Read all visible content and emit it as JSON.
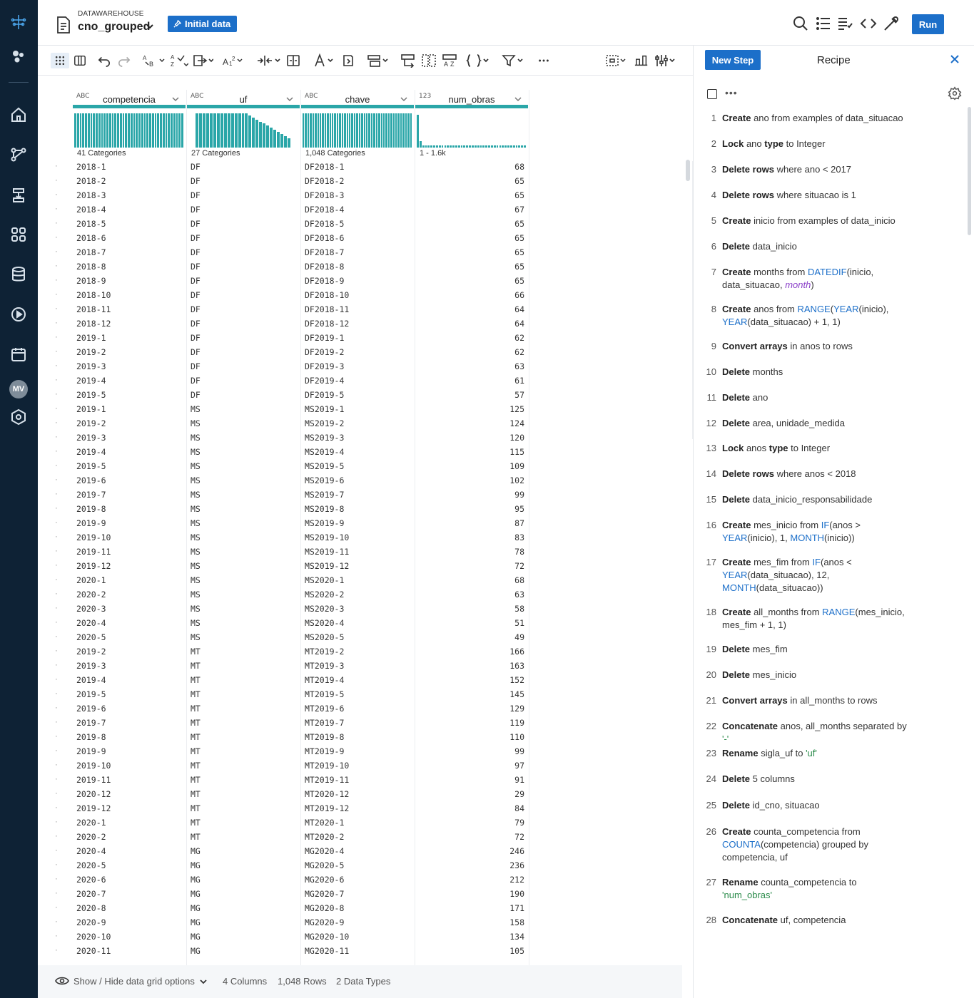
{
  "header": {
    "kicker": "DATAWAREHOUSE",
    "dataset_name": "cno_grouped",
    "initial_data_label": "Initial data",
    "run_label": "Run"
  },
  "grid": {
    "columns": [
      {
        "type_icon": "ABC",
        "name": "competencia",
        "summary": "41 Categories"
      },
      {
        "type_icon": "ABC",
        "name": "uf",
        "summary": "27 Categories"
      },
      {
        "type_icon": "ABC",
        "name": "chave",
        "summary": "1,048 Categories"
      },
      {
        "type_icon": "123",
        "name": "num_obras",
        "summary": "1 - 1.6k"
      }
    ],
    "rows": [
      [
        "2018-1",
        "DF",
        "DF2018-1",
        "68"
      ],
      [
        "2018-2",
        "DF",
        "DF2018-2",
        "65"
      ],
      [
        "2018-3",
        "DF",
        "DF2018-3",
        "65"
      ],
      [
        "2018-4",
        "DF",
        "DF2018-4",
        "67"
      ],
      [
        "2018-5",
        "DF",
        "DF2018-5",
        "65"
      ],
      [
        "2018-6",
        "DF",
        "DF2018-6",
        "65"
      ],
      [
        "2018-7",
        "DF",
        "DF2018-7",
        "65"
      ],
      [
        "2018-8",
        "DF",
        "DF2018-8",
        "65"
      ],
      [
        "2018-9",
        "DF",
        "DF2018-9",
        "65"
      ],
      [
        "2018-10",
        "DF",
        "DF2018-10",
        "66"
      ],
      [
        "2018-11",
        "DF",
        "DF2018-11",
        "64"
      ],
      [
        "2018-12",
        "DF",
        "DF2018-12",
        "64"
      ],
      [
        "2019-1",
        "DF",
        "DF2019-1",
        "62"
      ],
      [
        "2019-2",
        "DF",
        "DF2019-2",
        "62"
      ],
      [
        "2019-3",
        "DF",
        "DF2019-3",
        "63"
      ],
      [
        "2019-4",
        "DF",
        "DF2019-4",
        "61"
      ],
      [
        "2019-5",
        "DF",
        "DF2019-5",
        "57"
      ],
      [
        "2019-1",
        "MS",
        "MS2019-1",
        "125"
      ],
      [
        "2019-2",
        "MS",
        "MS2019-2",
        "124"
      ],
      [
        "2019-3",
        "MS",
        "MS2019-3",
        "120"
      ],
      [
        "2019-4",
        "MS",
        "MS2019-4",
        "115"
      ],
      [
        "2019-5",
        "MS",
        "MS2019-5",
        "109"
      ],
      [
        "2019-6",
        "MS",
        "MS2019-6",
        "102"
      ],
      [
        "2019-7",
        "MS",
        "MS2019-7",
        "99"
      ],
      [
        "2019-8",
        "MS",
        "MS2019-8",
        "95"
      ],
      [
        "2019-9",
        "MS",
        "MS2019-9",
        "87"
      ],
      [
        "2019-10",
        "MS",
        "MS2019-10",
        "83"
      ],
      [
        "2019-11",
        "MS",
        "MS2019-11",
        "78"
      ],
      [
        "2019-12",
        "MS",
        "MS2019-12",
        "72"
      ],
      [
        "2020-1",
        "MS",
        "MS2020-1",
        "68"
      ],
      [
        "2020-2",
        "MS",
        "MS2020-2",
        "63"
      ],
      [
        "2020-3",
        "MS",
        "MS2020-3",
        "58"
      ],
      [
        "2020-4",
        "MS",
        "MS2020-4",
        "51"
      ],
      [
        "2020-5",
        "MS",
        "MS2020-5",
        "49"
      ],
      [
        "2019-2",
        "MT",
        "MT2019-2",
        "166"
      ],
      [
        "2019-3",
        "MT",
        "MT2019-3",
        "163"
      ],
      [
        "2019-4",
        "MT",
        "MT2019-4",
        "152"
      ],
      [
        "2019-5",
        "MT",
        "MT2019-5",
        "145"
      ],
      [
        "2019-6",
        "MT",
        "MT2019-6",
        "129"
      ],
      [
        "2019-7",
        "MT",
        "MT2019-7",
        "119"
      ],
      [
        "2019-8",
        "MT",
        "MT2019-8",
        "110"
      ],
      [
        "2019-9",
        "MT",
        "MT2019-9",
        "99"
      ],
      [
        "2019-10",
        "MT",
        "MT2019-10",
        "97"
      ],
      [
        "2019-11",
        "MT",
        "MT2019-11",
        "91"
      ],
      [
        "2020-12",
        "MT",
        "MT2020-12",
        "29"
      ],
      [
        "2019-12",
        "MT",
        "MT2019-12",
        "84"
      ],
      [
        "2020-1",
        "MT",
        "MT2020-1",
        "79"
      ],
      [
        "2020-2",
        "MT",
        "MT2020-2",
        "72"
      ],
      [
        "2020-4",
        "MG",
        "MG2020-4",
        "246"
      ],
      [
        "2020-5",
        "MG",
        "MG2020-5",
        "236"
      ],
      [
        "2020-6",
        "MG",
        "MG2020-6",
        "212"
      ],
      [
        "2020-7",
        "MG",
        "MG2020-7",
        "190"
      ],
      [
        "2020-8",
        "MG",
        "MG2020-8",
        "171"
      ],
      [
        "2020-9",
        "MG",
        "MG2020-9",
        "158"
      ],
      [
        "2020-10",
        "MG",
        "MG2020-10",
        "134"
      ],
      [
        "2020-11",
        "MG",
        "MG2020-11",
        "105"
      ]
    ]
  },
  "footer": {
    "grid_options_label": "Show / Hide data grid options",
    "columns_count": "4 Columns",
    "rows_count": "1,048 Rows",
    "types_count": "2 Data Types"
  },
  "recipe": {
    "new_step_label": "New Step",
    "title": "Recipe",
    "steps": [
      {
        "num": "1",
        "html": "<b>Create</b> ano from examples of data_situacao"
      },
      {
        "num": "2",
        "html": "<b>Lock</b> ano <b>type</b> to Integer"
      },
      {
        "num": "3",
        "html": "<b>Delete rows</b> where ano &lt; 2017"
      },
      {
        "num": "4",
        "html": "<b>Delete rows</b> where situacao is 1"
      },
      {
        "num": "5",
        "html": "<b>Create</b> inicio from examples of data_inicio"
      },
      {
        "num": "6",
        "html": "<b>Delete</b> data_inicio"
      },
      {
        "num": "7",
        "html": "<b>Create</b> months from <span class='fn'>DATEDIF</span>(inicio,<br>data_situacao, <span class='kw'>month</span>)"
      },
      {
        "num": "8",
        "html": "<b>Create</b> anos from <span class='fn'>RANGE</span>(<span class='fn'>YEAR</span>(inicio),<br><span class='fn'>YEAR</span>(data_situacao) + 1, 1)"
      },
      {
        "num": "9",
        "html": "<b>Convert arrays</b> in anos to rows"
      },
      {
        "num": "10",
        "html": "<b>Delete</b> months"
      },
      {
        "num": "11",
        "html": "<b>Delete</b> ano"
      },
      {
        "num": "12",
        "html": "<b>Delete</b> area, unidade_medida"
      },
      {
        "num": "13",
        "html": "<b>Lock</b> anos <b>type</b> to Integer"
      },
      {
        "num": "14",
        "html": "<b>Delete rows</b> where anos &lt; 2018"
      },
      {
        "num": "15",
        "html": "<b>Delete</b> data_inicio_responsabilidade"
      },
      {
        "num": "16",
        "html": "<b>Create</b> mes_inicio from <span class='fn'>IF</span>(anos &gt;<br><span class='fn'>YEAR</span>(inicio), 1, <span class='fn'>MONTH</span>(inicio))"
      },
      {
        "num": "17",
        "html": "<b>Create</b> mes_fim from <span class='fn'>IF</span>(anos &lt;<br><span class='fn'>YEAR</span>(data_situacao), 12,<br><span class='fn'>MONTH</span>(data_situacao))"
      },
      {
        "num": "18",
        "html": "<b>Create</b> all_months from <span class='fn'>RANGE</span>(mes_inicio,<br>mes_fim + 1, 1)"
      },
      {
        "num": "19",
        "html": "<b>Delete</b> mes_fim"
      },
      {
        "num": "20",
        "html": "<b>Delete</b> mes_inicio"
      },
      {
        "num": "21",
        "html": "<b>Convert arrays</b> in all_months to rows"
      },
      {
        "num": "22",
        "html": "<b>Concatenate</b> anos, all_months separated by<br><span class='str'>'-'</span>"
      },
      {
        "num": "23",
        "html": "<b>Rename</b> sigla_uf to <span class='str'>'uf'</span>"
      },
      {
        "num": "24",
        "html": "<b>Delete</b> 5 columns"
      },
      {
        "num": "25",
        "html": "<b>Delete</b> id_cno, situacao"
      },
      {
        "num": "26",
        "html": "<b>Create</b> counta_competencia from<br><span class='fn'>COUNTA</span>(competencia) grouped by<br>competencia, uf"
      },
      {
        "num": "27",
        "html": "<b>Rename</b> counta_competencia to<br><span class='str'>'num_obras'</span>"
      },
      {
        "num": "28",
        "html": "<b>Concatenate</b> uf, competencia"
      }
    ]
  },
  "user": {
    "initials": "MV"
  },
  "colors": {
    "accent": "#1c6fc9",
    "histogram": "#2aa6a8",
    "nav_bg": "#0e2235"
  }
}
